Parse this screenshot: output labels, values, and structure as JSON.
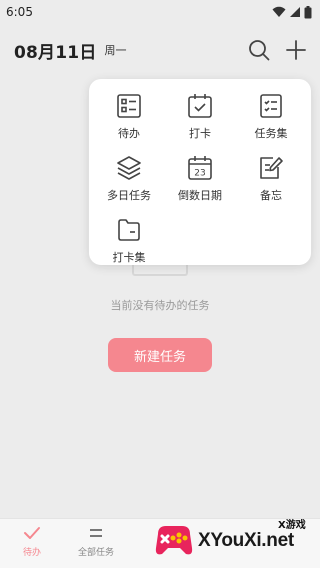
{
  "status_bar": {
    "time": "6:05"
  },
  "header": {
    "date": "08月11日",
    "weekday": "周一"
  },
  "popup_menu": {
    "items": [
      {
        "label": "待办",
        "icon": "todo-list-icon"
      },
      {
        "label": "打卡",
        "icon": "checkin-calendar-icon"
      },
      {
        "label": "任务集",
        "icon": "task-set-icon"
      },
      {
        "label": "多日任务",
        "icon": "layers-icon"
      },
      {
        "label": "倒数日期",
        "icon": "countdown-calendar-icon",
        "day": "23"
      },
      {
        "label": "备忘",
        "icon": "memo-edit-icon"
      },
      {
        "label": "打卡集",
        "icon": "folder-icon"
      }
    ]
  },
  "empty_state": {
    "text": "当前没有待办的任务",
    "button": "新建任务"
  },
  "bottom_nav": {
    "tabs": [
      {
        "label": "待办",
        "icon": "check-icon",
        "active": true
      },
      {
        "label": "全部任务",
        "icon": "list-icon",
        "active": false
      }
    ]
  },
  "watermark": {
    "top": "X游戏",
    "main": "XYouXi.net"
  },
  "colors": {
    "accent": "#f5878f",
    "background": "#ececec",
    "popup": "#ffffff"
  }
}
